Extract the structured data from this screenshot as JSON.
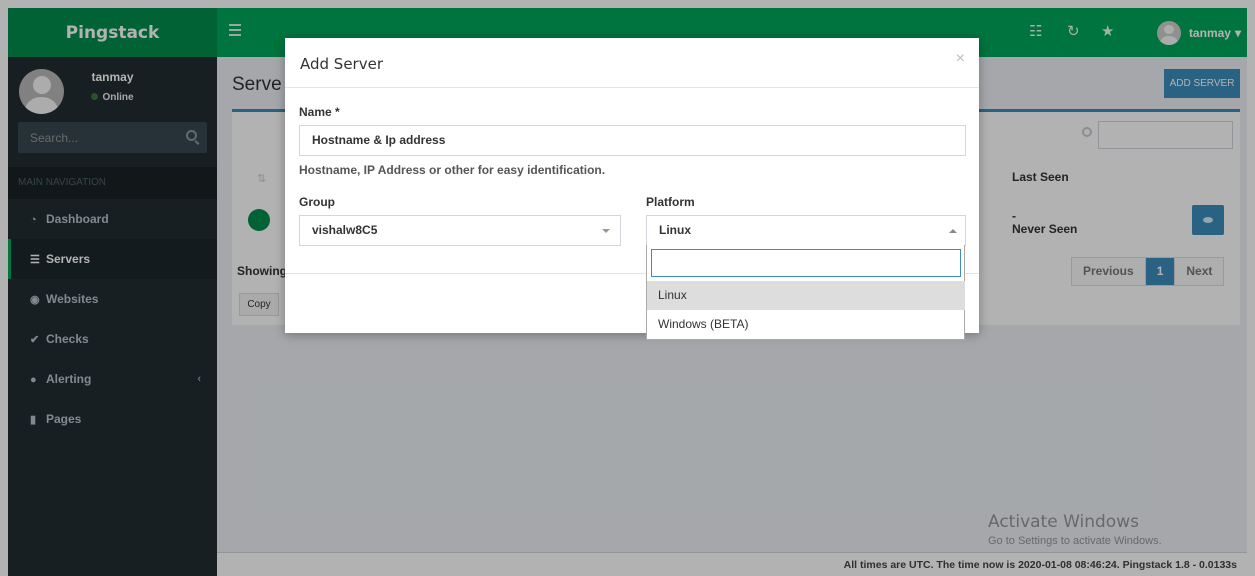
{
  "app": {
    "name": "Pingstack"
  },
  "topbar": {
    "menu_icon": "hamburger-icon",
    "icons": [
      "tasks-icon",
      "refresh-icon",
      "star-icon"
    ],
    "user": "tanmay",
    "user_caret": "▾"
  },
  "sidebar": {
    "user": {
      "name": "tanmay",
      "status": "Online",
      "status_color": "#3c763d"
    },
    "search": {
      "placeholder": "Search..."
    },
    "header": "MAIN NAVIGATION",
    "items": [
      {
        "label": "Dashboard",
        "icon": "dashboard-icon"
      },
      {
        "label": "Servers",
        "icon": "servers-icon",
        "active": true
      },
      {
        "label": "Websites",
        "icon": "globe-icon"
      },
      {
        "label": "Checks",
        "icon": "check-icon"
      },
      {
        "label": "Alerting",
        "icon": "comments-icon",
        "chevron": "‹"
      },
      {
        "label": "Pages",
        "icon": "bookmark-icon"
      }
    ]
  },
  "page": {
    "title": "Serve",
    "add_button": "ADD SERVER",
    "table": {
      "last_seen_header": "Last Seen",
      "last_seen_dash": "-",
      "last_seen_value": "Never Seen",
      "showing": "Showing",
      "copy_button": "Copy"
    },
    "pagination": {
      "previous": "Previous",
      "current": "1",
      "next": "Next"
    }
  },
  "footer": {
    "text": "All times are UTC. The time now is 2020-01-08 08:46:24. Pingstack 1.8 - 0.0133s"
  },
  "watermark": {
    "title": "Activate Windows",
    "subtitle": "Go to Settings to activate Windows."
  },
  "modal": {
    "title": "Add Server",
    "close": "×",
    "name_label": "Name *",
    "name_value": "Hostname & Ip address",
    "name_help": "Hostname, IP Address or other for easy identification.",
    "group_label": "Group",
    "group_value": "vishalw8C5",
    "platform_label": "Platform",
    "platform_value": "Linux",
    "platform_options": [
      "Linux",
      "Windows (BETA)"
    ],
    "highlighted_option": "Linux"
  },
  "colors": {
    "brand": "#00a65a",
    "brand_dark": "#008d4c",
    "accent": "#3c8dbc",
    "sidebar": "#222d32"
  }
}
